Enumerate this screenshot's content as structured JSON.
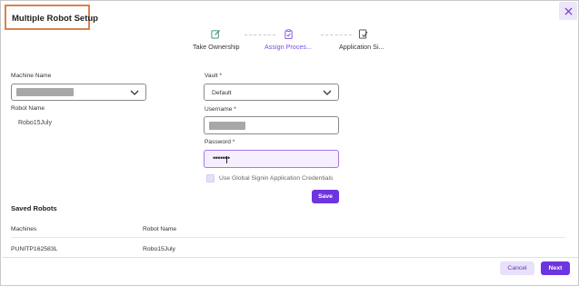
{
  "dialog": {
    "title": "Multiple Robot Setup"
  },
  "stepper": {
    "steps": [
      {
        "label": "Take Ownership",
        "icon": "edit-square-icon"
      },
      {
        "label": "Assign Proces...",
        "icon": "clipboard-check-icon"
      },
      {
        "label": "Application Si...",
        "icon": "document-check-icon"
      }
    ],
    "active_step": 2
  },
  "form": {
    "machine_name": {
      "label": "Machine Name"
    },
    "robot_name": {
      "label": "Robot Name",
      "value": "Robo15July"
    },
    "vault": {
      "label": "Vault *",
      "value": "Default"
    },
    "username": {
      "label": "Username *"
    },
    "password": {
      "label": "Password *",
      "value": "•••••••"
    },
    "global_signin_checkbox_label": "Use Global Signin Application Credentials",
    "save_label": "Save"
  },
  "saved_robots": {
    "title": "Saved Robots",
    "columns": [
      "Machines",
      "Robot Name"
    ],
    "rows": [
      [
        "PUNITP162583L",
        "Robo15July"
      ]
    ]
  },
  "footer": {
    "cancel_label": "Cancel",
    "next_label": "Next"
  },
  "colors": {
    "accent": "#6d35e0",
    "accent_light": "#e9e0fb",
    "title_highlight": "#d9824b",
    "step_active": "#7b4ae8",
    "step_done": "#2e8b7a"
  }
}
